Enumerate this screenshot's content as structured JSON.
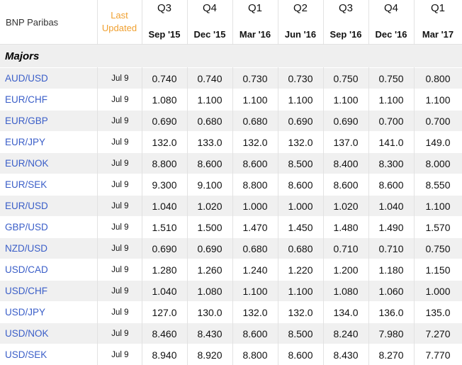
{
  "header": {
    "source": "BNP Paribas",
    "updated_line1": "Last",
    "updated_line2": "Updated",
    "quarters": [
      {
        "label": "Q3",
        "date": "Sep '15"
      },
      {
        "label": "Q4",
        "date": "Dec '15"
      },
      {
        "label": "Q1",
        "date": "Mar '16"
      },
      {
        "label": "Q2",
        "date": "Jun '16"
      },
      {
        "label": "Q3",
        "date": "Sep '16"
      },
      {
        "label": "Q4",
        "date": "Dec '16"
      },
      {
        "label": "Q1",
        "date": "Mar '17"
      }
    ]
  },
  "section": {
    "title": "Majors"
  },
  "colors": {
    "link": "#3a5ec8",
    "updated_header": "#f0a030",
    "row_alt": "#f0f0f0"
  },
  "rows": [
    {
      "pair": "AUD/USD",
      "updated": "Jul 9",
      "values": [
        "0.740",
        "0.740",
        "0.730",
        "0.730",
        "0.750",
        "0.750",
        "0.800"
      ]
    },
    {
      "pair": "EUR/CHF",
      "updated": "Jul 9",
      "values": [
        "1.080",
        "1.100",
        "1.100",
        "1.100",
        "1.100",
        "1.100",
        "1.100"
      ]
    },
    {
      "pair": "EUR/GBP",
      "updated": "Jul 9",
      "values": [
        "0.690",
        "0.680",
        "0.680",
        "0.690",
        "0.690",
        "0.700",
        "0.700"
      ]
    },
    {
      "pair": "EUR/JPY",
      "updated": "Jul 9",
      "values": [
        "132.0",
        "133.0",
        "132.0",
        "132.0",
        "137.0",
        "141.0",
        "149.0"
      ]
    },
    {
      "pair": "EUR/NOK",
      "updated": "Jul 9",
      "values": [
        "8.800",
        "8.600",
        "8.600",
        "8.500",
        "8.400",
        "8.300",
        "8.000"
      ]
    },
    {
      "pair": "EUR/SEK",
      "updated": "Jul 9",
      "values": [
        "9.300",
        "9.100",
        "8.800",
        "8.600",
        "8.600",
        "8.600",
        "8.550"
      ]
    },
    {
      "pair": "EUR/USD",
      "updated": "Jul 9",
      "values": [
        "1.040",
        "1.020",
        "1.000",
        "1.000",
        "1.020",
        "1.040",
        "1.100"
      ]
    },
    {
      "pair": "GBP/USD",
      "updated": "Jul 9",
      "values": [
        "1.510",
        "1.500",
        "1.470",
        "1.450",
        "1.480",
        "1.490",
        "1.570"
      ]
    },
    {
      "pair": "NZD/USD",
      "updated": "Jul 9",
      "values": [
        "0.690",
        "0.690",
        "0.680",
        "0.680",
        "0.710",
        "0.710",
        "0.750"
      ]
    },
    {
      "pair": "USD/CAD",
      "updated": "Jul 9",
      "values": [
        "1.280",
        "1.260",
        "1.240",
        "1.220",
        "1.200",
        "1.180",
        "1.150"
      ]
    },
    {
      "pair": "USD/CHF",
      "updated": "Jul 9",
      "values": [
        "1.040",
        "1.080",
        "1.100",
        "1.100",
        "1.080",
        "1.060",
        "1.000"
      ]
    },
    {
      "pair": "USD/JPY",
      "updated": "Jul 9",
      "values": [
        "127.0",
        "130.0",
        "132.0",
        "132.0",
        "134.0",
        "136.0",
        "135.0"
      ]
    },
    {
      "pair": "USD/NOK",
      "updated": "Jul 9",
      "values": [
        "8.460",
        "8.430",
        "8.600",
        "8.500",
        "8.240",
        "7.980",
        "7.270"
      ]
    },
    {
      "pair": "USD/SEK",
      "updated": "Jul 9",
      "values": [
        "8.940",
        "8.920",
        "8.800",
        "8.600",
        "8.430",
        "8.270",
        "7.770"
      ]
    }
  ]
}
